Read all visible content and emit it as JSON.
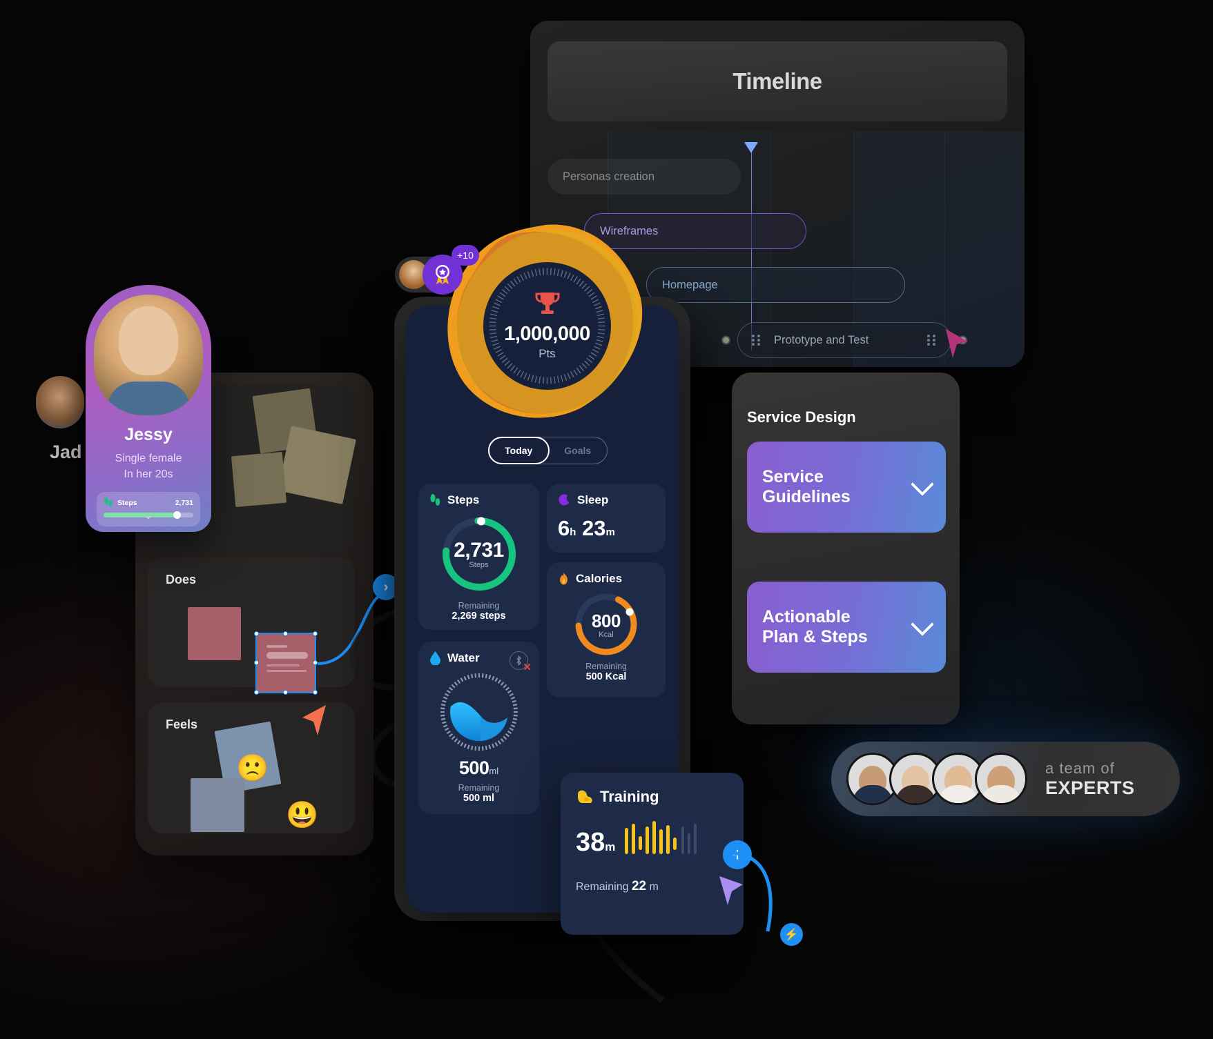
{
  "timeline": {
    "title": "Timeline",
    "bars": [
      {
        "label": "Personas creation",
        "style": "plain"
      },
      {
        "label": "Wireframes",
        "style": "purple"
      },
      {
        "label": "Homepage",
        "style": "blue"
      },
      {
        "label": "Prototype and Test",
        "style": "steel"
      }
    ],
    "playhead_icon": "playhead-marker-icon",
    "grip_icon": "drag-grip-icon"
  },
  "persona": {
    "name": "Jessy",
    "desc_line1": "Single female",
    "desc_line2": "In her 20s",
    "steps_label": "Steps",
    "steps_value": "2,731",
    "steps_progress_pct": 78,
    "expand_icon": "chevron-down-icon",
    "footprint_icon": "footprints-icon",
    "background_name_fragment": "Jad"
  },
  "empathy_map": {
    "does_title": "Does",
    "feels_title": "Feels",
    "emoji_sad": "🙁",
    "emoji_happy": "😃"
  },
  "points_badge": {
    "value": "1,000,000",
    "unit": "Pts",
    "trophy_icon": "trophy-icon",
    "medal_icon": "medal-ribbon-icon",
    "increment": "+10"
  },
  "phone": {
    "tabs": [
      {
        "label": "Today",
        "active": true
      },
      {
        "label": "Goals",
        "active": false
      }
    ],
    "cards": {
      "steps": {
        "title": "Steps",
        "icon": "footprints-icon",
        "value": "2,731",
        "unit": "Steps",
        "remaining_label": "Remaining",
        "remaining_value": "2,269 steps",
        "progress_pct": 55,
        "color": "#17c47f"
      },
      "sleep": {
        "title": "Sleep",
        "icon": "moon-icon",
        "hours": "6",
        "hours_unit": "h",
        "minutes": "23",
        "minutes_unit": "m",
        "color": "#8a2be2"
      },
      "calories": {
        "title": "Calories",
        "icon": "fire-icon",
        "value": "800",
        "unit": "Kcal",
        "remaining_label": "Remaining",
        "remaining_value": "500 Kcal",
        "progress_pct": 62,
        "color": "#f08a1e"
      },
      "water": {
        "title": "Water",
        "icon": "water-drop-icon",
        "bluetooth_icon": "bluetooth-disconnected-icon",
        "value": "500",
        "unit": "ml",
        "remaining_label": "Remaining",
        "remaining_value": "500 ml",
        "color": "#1da9f0"
      }
    }
  },
  "training": {
    "title": "Training",
    "icon": "flexed-biceps-icon",
    "value": "38",
    "unit": "m",
    "remaining_label": "Remaining",
    "remaining_value": "22",
    "remaining_unit": "m",
    "add_icon": "plus-icon",
    "waveform_color": "#f5c319"
  },
  "service_design": {
    "title": "Service Design",
    "cards": [
      {
        "line1": "Service",
        "line2": "Guidelines",
        "chevron": "chevron-down-icon"
      },
      {
        "line1": "Actionable",
        "line2": "Plan & Steps",
        "chevron": "chevron-down-icon"
      }
    ]
  },
  "experts": {
    "line1": "a team of",
    "line2": "EXPERTS",
    "avatar_count": 4
  },
  "accents": {
    "blue": "#1d8ff5",
    "purple": "#7231d6",
    "green": "#17c47f",
    "orange": "#f08a1e",
    "magenta": "#b4367a",
    "violet_cursor": "#a98df0"
  }
}
